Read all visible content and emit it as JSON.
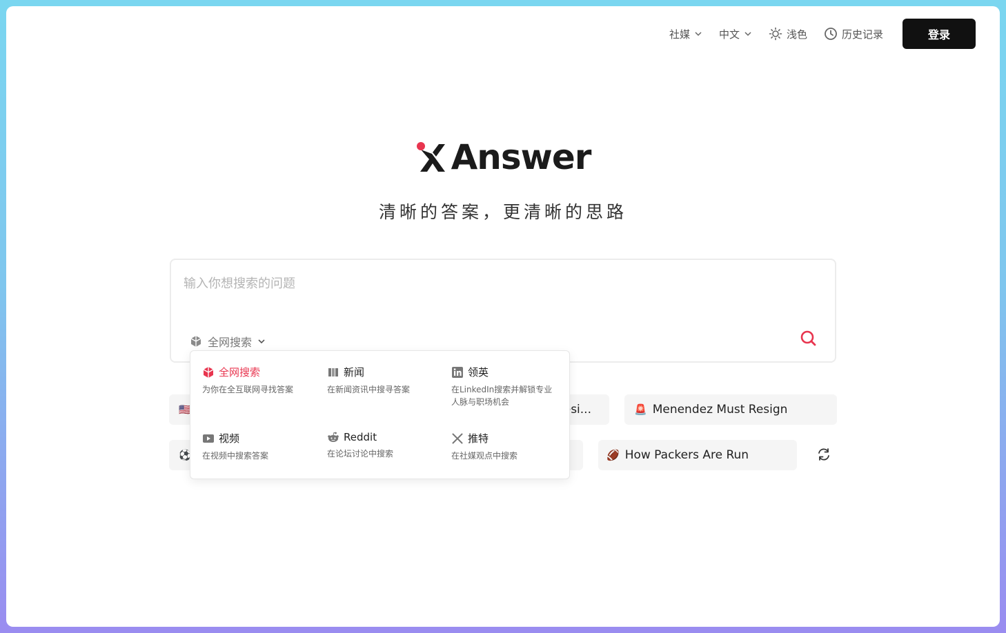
{
  "topbar": {
    "social": "社媒",
    "language": "中文",
    "theme": "浅色",
    "history": "历史记录",
    "login": "登录"
  },
  "logo": {
    "text": "Answer"
  },
  "tagline": "清晰的答案，更清晰的思路",
  "search": {
    "placeholder": "输入你想搜索的问题",
    "source": "全网搜索"
  },
  "chips": [
    {
      "emoji": "🇺🇸",
      "label": ""
    },
    {
      "emoji": "",
      "label": "esi..."
    },
    {
      "emoji": "🚨",
      "label": "Menendez Must Resign"
    },
    {
      "emoji": "⚽",
      "label": ""
    },
    {
      "emoji": "",
      "label": ""
    },
    {
      "emoji": "🏈",
      "label": "How Packers Are Run"
    }
  ],
  "dropdown": {
    "options": [
      {
        "icon": "web-icon",
        "title": "全网搜索",
        "desc": "为你在全互联网寻找答案",
        "active": true
      },
      {
        "icon": "news-icon",
        "title": "新闻",
        "desc": "在新闻资讯中搜寻答案",
        "active": false
      },
      {
        "icon": "linkedin-icon",
        "title": "领英",
        "desc": "在LinkedIn搜索并解锁专业人脉与职场机会",
        "active": false
      },
      {
        "icon": "video-icon",
        "title": "视频",
        "desc": "在视频中搜索答案",
        "active": false
      },
      {
        "icon": "reddit-icon",
        "title": "Reddit",
        "desc": "在论坛讨论中搜索",
        "active": false
      },
      {
        "icon": "x-icon",
        "title": "推特",
        "desc": "在社媒观点中搜索",
        "active": false
      }
    ]
  },
  "colors": {
    "accent": "#e8354f",
    "dark": "#111111"
  }
}
